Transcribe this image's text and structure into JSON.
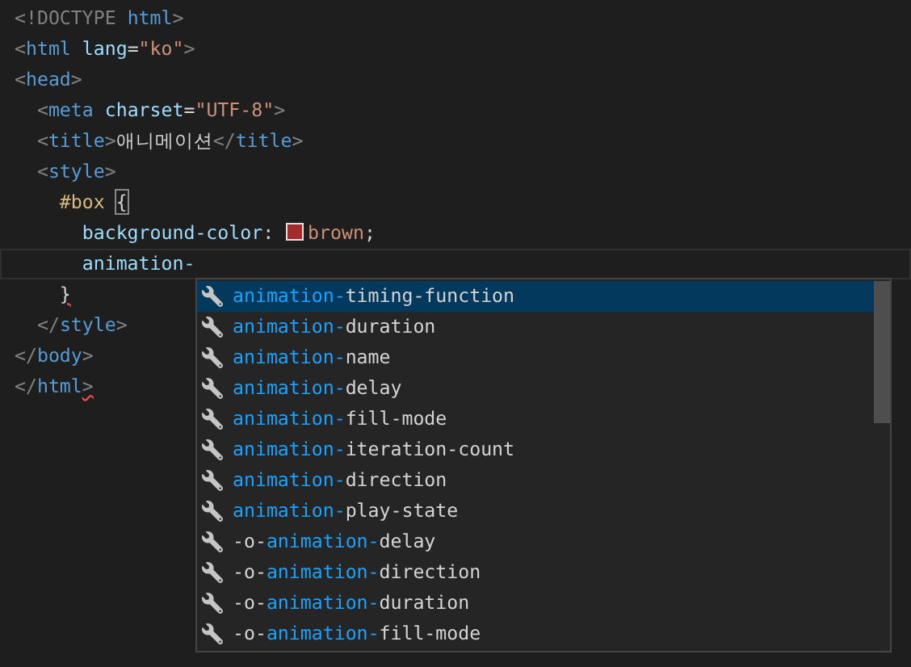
{
  "editor": {
    "lines": [
      {
        "tokens": [
          {
            "kind": "punct",
            "text": "<!DOCTYPE"
          },
          {
            "kind": "tag",
            "text": " html"
          },
          {
            "kind": "punct",
            "text": ">"
          }
        ]
      },
      {
        "tokens": [
          {
            "kind": "punct",
            "text": "<"
          },
          {
            "kind": "tag",
            "text": "html"
          },
          {
            "kind": "attr",
            "text": " lang"
          },
          {
            "kind": "text",
            "text": "="
          },
          {
            "kind": "string",
            "text": "\"ko\""
          },
          {
            "kind": "punct",
            "text": ">"
          }
        ]
      },
      {
        "tokens": [
          {
            "kind": "punct",
            "text": "<"
          },
          {
            "kind": "tag",
            "text": "head"
          },
          {
            "kind": "punct",
            "text": ">"
          }
        ]
      },
      {
        "tokens": [
          {
            "kind": "punct",
            "text": "  <"
          },
          {
            "kind": "tag",
            "text": "meta"
          },
          {
            "kind": "attr",
            "text": " charset"
          },
          {
            "kind": "text",
            "text": "="
          },
          {
            "kind": "string",
            "text": "\"UTF-8\""
          },
          {
            "kind": "punct",
            "text": ">"
          }
        ]
      },
      {
        "tokens": [
          {
            "kind": "punct",
            "text": "  <"
          },
          {
            "kind": "tag",
            "text": "title"
          },
          {
            "kind": "punct",
            "text": ">"
          },
          {
            "kind": "text",
            "text": "애니메이션"
          },
          {
            "kind": "punct",
            "text": "</"
          },
          {
            "kind": "tag",
            "text": "title"
          },
          {
            "kind": "punct",
            "text": ">"
          }
        ]
      },
      {
        "tokens": [
          {
            "kind": "punct",
            "text": "  <"
          },
          {
            "kind": "tag",
            "text": "style"
          },
          {
            "kind": "punct",
            "text": ">"
          }
        ]
      },
      {
        "tokens": [
          {
            "kind": "selector",
            "text": "    #box "
          },
          {
            "kind": "text",
            "text": "{",
            "matched": true
          }
        ]
      },
      {
        "tokens": [
          {
            "kind": "property",
            "text": "      background-color"
          },
          {
            "kind": "text",
            "text": ": "
          },
          {
            "kind": "swatch",
            "color": "#a52a2a"
          },
          {
            "kind": "value",
            "text": "brown"
          },
          {
            "kind": "text",
            "text": ";"
          }
        ]
      },
      {
        "current": true,
        "tokens": [
          {
            "kind": "property",
            "text": "      animation-"
          }
        ]
      },
      {
        "tokens": [
          {
            "kind": "text",
            "text": "    }",
            "error": true
          }
        ]
      },
      {
        "tokens": [
          {
            "kind": "punct",
            "text": "  </"
          },
          {
            "kind": "tag",
            "text": "style"
          },
          {
            "kind": "punct",
            "text": ">"
          }
        ]
      },
      {
        "tokens": [
          {
            "kind": "punct",
            "text": "</"
          },
          {
            "kind": "tag",
            "text": "body"
          },
          {
            "kind": "punct",
            "text": ">"
          }
        ]
      },
      {
        "tokens": [
          {
            "kind": "punct",
            "text": "</"
          },
          {
            "kind": "tag",
            "text": "html"
          },
          {
            "kind": "punct",
            "text": ">",
            "error": true
          }
        ]
      }
    ]
  },
  "suggestions": [
    {
      "match": "animation-",
      "rest": "timing-function",
      "selected": true
    },
    {
      "match": "animation-",
      "rest": "duration",
      "selected": false
    },
    {
      "match": "animation-",
      "rest": "name",
      "selected": false
    },
    {
      "match": "animation-",
      "rest": "delay",
      "selected": false
    },
    {
      "match": "animation-",
      "rest": "fill-mode",
      "selected": false
    },
    {
      "match": "animation-",
      "rest": "iteration-count",
      "selected": false
    },
    {
      "match": "animation-",
      "rest": "direction",
      "selected": false
    },
    {
      "match": "animation-",
      "rest": "play-state",
      "selected": false
    },
    {
      "prefix": "-o-",
      "match": "animation-",
      "rest": "delay",
      "selected": false
    },
    {
      "prefix": "-o-",
      "match": "animation-",
      "rest": "direction",
      "selected": false
    },
    {
      "prefix": "-o-",
      "match": "animation-",
      "rest": "duration",
      "selected": false
    },
    {
      "prefix": "-o-",
      "match": "animation-",
      "rest": "fill-mode",
      "selected": false
    }
  ]
}
